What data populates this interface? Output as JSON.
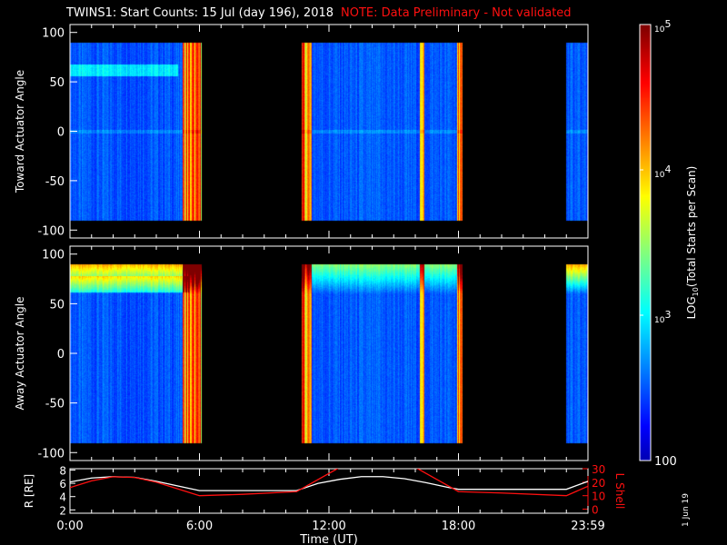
{
  "title": "TWINS1: Start Counts: 15 Jul (day 196), 2018",
  "note": "NOTE: Data Preliminary - Not validated",
  "footer_date": "1 Jun 19",
  "colors": {
    "note": "#ff1010",
    "r_line": "#ffffff",
    "lshell_line": "#ff1010"
  },
  "chart_data": [
    {
      "type": "heatmap",
      "name": "toward",
      "ylabel": "Toward Actuator Angle",
      "ylim": [
        -108,
        108
      ],
      "yticks": [
        "100",
        "50",
        "0",
        "-50",
        "-100"
      ],
      "ytick_values": [
        100,
        50,
        0,
        -50,
        -100
      ],
      "data_angle_range": [
        -90,
        90
      ],
      "xlim_hours": [
        0,
        24
      ],
      "coverage_hours": [
        [
          0,
          6.1
        ],
        [
          10.7,
          18.15
        ],
        [
          22.95,
          24
        ]
      ]
    },
    {
      "type": "heatmap",
      "name": "away",
      "ylabel": "Away Actuator Angle",
      "ylim": [
        -108,
        108
      ],
      "yticks": [
        "100",
        "50",
        "0",
        "-50",
        "-100"
      ],
      "ytick_values": [
        100,
        50,
        0,
        -50,
        -100
      ],
      "data_angle_range": [
        -90,
        90
      ],
      "xlim_hours": [
        0,
        24
      ],
      "coverage_hours": [
        [
          0,
          6.1
        ],
        [
          10.7,
          18.15
        ],
        [
          22.95,
          24
        ]
      ]
    },
    {
      "type": "line",
      "name": "ephemeris",
      "ylabel": "R [RE]",
      "ylabel_right": "L Shell",
      "xlabel": "Time (UT)",
      "xticks": [
        "0:00",
        "6:00",
        "12:00",
        "18:00",
        "23:59"
      ],
      "xtick_values": [
        0,
        6,
        12,
        18,
        24
      ],
      "yticks_left": [
        "8",
        "6",
        "4",
        "2"
      ],
      "ytick_left_values": [
        8,
        6,
        4,
        2
      ],
      "ylim_left": [
        1.5,
        8.2
      ],
      "yticks_right": [
        "30",
        "20",
        "10",
        "0"
      ],
      "ytick_right_values": [
        30,
        20,
        10,
        0
      ],
      "ylim_right": [
        -3,
        30
      ],
      "series": [
        {
          "name": "R",
          "x": [
            0,
            1,
            2,
            3,
            4,
            5,
            6,
            10.5,
            11.5,
            12.5,
            13.5,
            14.5,
            15.5,
            16.5,
            17.5,
            18,
            23,
            24
          ],
          "y": [
            6.2,
            6.8,
            7.0,
            6.9,
            6.3,
            5.6,
            4.9,
            4.9,
            6.0,
            6.6,
            7.0,
            7.0,
            6.7,
            6.1,
            5.4,
            5.1,
            5.1,
            6.3
          ]
        },
        {
          "name": "L Shell",
          "x": [
            0,
            1,
            2,
            3,
            4,
            5,
            6,
            8,
            10.5,
            12.5,
            16,
            18,
            20,
            23,
            24
          ],
          "y": [
            16,
            21,
            24,
            23.5,
            20,
            15,
            10,
            11,
            13,
            31,
            31,
            13,
            12,
            10,
            17
          ]
        }
      ]
    },
    {
      "type": "colorbar",
      "label": "LOG10(Total Starts per Scan)",
      "label_prefix": "LOG",
      "label_sub": "10",
      "label_suffix": "(Total Starts per Scan)",
      "ticks": [
        "10^5",
        "10^4",
        "10^3",
        "100"
      ],
      "tick_values_log": [
        5,
        4,
        3,
        2
      ],
      "range_log": [
        2,
        5
      ]
    }
  ]
}
